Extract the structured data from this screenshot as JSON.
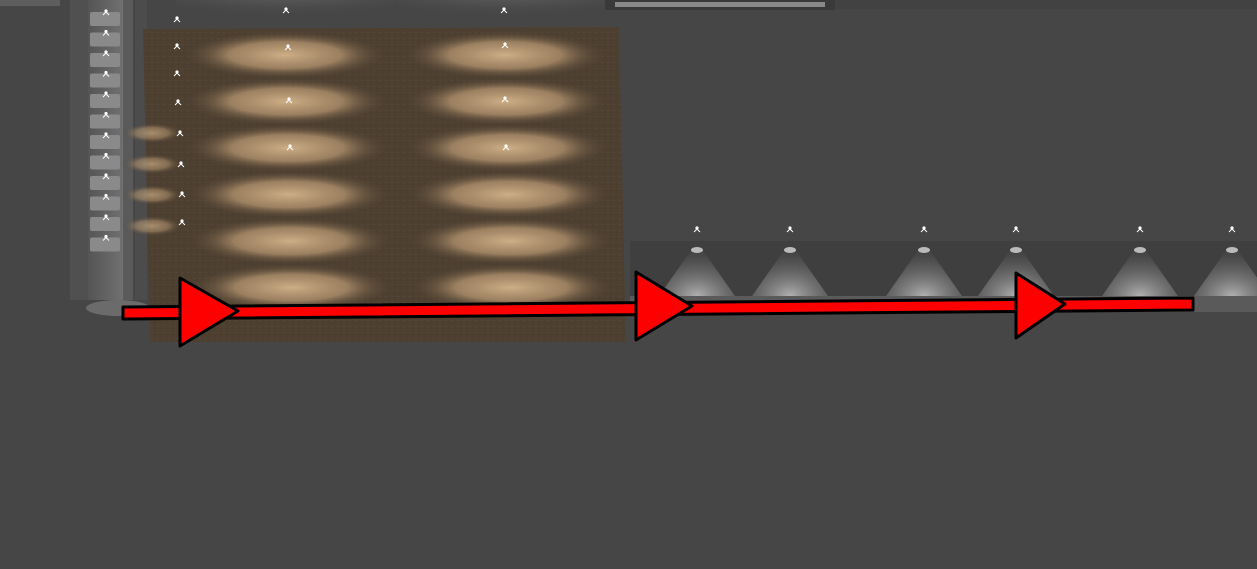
{
  "viewport": {
    "background": "#464646"
  },
  "floor_panel": {
    "texture_color": "#4e4031",
    "light_pool_color": "#c9a87c",
    "pool_rows": 6,
    "pool_columns": 2
  },
  "left_fixture_column": {
    "color": "#8a8a8a",
    "fixture_count": 12
  },
  "wall_strip": {
    "color": "#3f3f3f",
    "spotlight_count": 6,
    "light_color": "#d8d8d8"
  },
  "annotation_arrow": {
    "color": "#ff0000",
    "outline_color": "#000000",
    "direction": "right",
    "arrowhead_count": 3
  }
}
